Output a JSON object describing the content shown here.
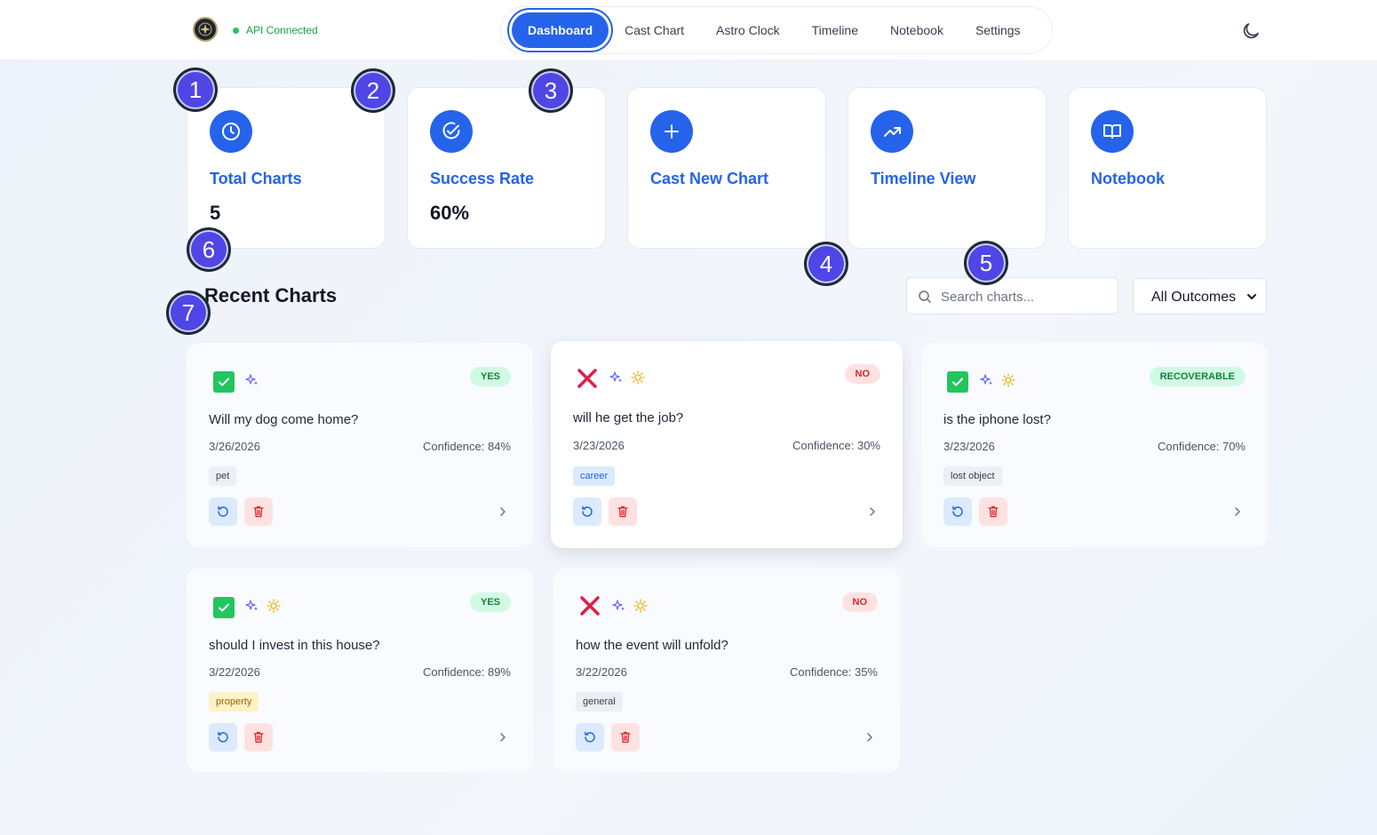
{
  "header": {
    "api_status": "API Connected",
    "nav": [
      "Dashboard",
      "Cast Chart",
      "Astro Clock",
      "Timeline",
      "Notebook",
      "Settings"
    ],
    "active_nav": "Dashboard"
  },
  "stats": [
    {
      "title": "Total Charts",
      "value": "5",
      "icon": "clock-icon"
    },
    {
      "title": "Success Rate",
      "value": "60%",
      "icon": "check-circle-icon"
    },
    {
      "title": "Cast New Chart",
      "value": "",
      "icon": "plus-icon"
    },
    {
      "title": "Timeline View",
      "value": "",
      "icon": "trending-up-icon"
    },
    {
      "title": "Notebook",
      "value": "",
      "icon": "book-icon"
    }
  ],
  "recent": {
    "title": "Recent Charts",
    "search_placeholder": "Search charts...",
    "filter_selected": "All Outcomes"
  },
  "charts": [
    {
      "question": "Will my dog come home?",
      "date": "3/26/2026",
      "confidence": "Confidence: 84%",
      "outcome": "YES",
      "tag": "pet",
      "status": "check-icon"
    },
    {
      "question": "will he get the job?",
      "date": "3/23/2026",
      "confidence": "Confidence: 30%",
      "outcome": "NO",
      "tag": "career",
      "status": "x-icon"
    },
    {
      "question": "is the iphone lost?",
      "date": "3/23/2026",
      "confidence": "Confidence: 70%",
      "outcome": "RECOVERABLE",
      "tag": "lost object",
      "status": "check-icon"
    },
    {
      "question": "should I invest in this house?",
      "date": "3/22/2026",
      "confidence": "Confidence: 89%",
      "outcome": "YES",
      "tag": "property",
      "status": "check-icon"
    },
    {
      "question": "how the event will unfold?",
      "date": "3/22/2026",
      "confidence": "Confidence: 35%",
      "outcome": "NO",
      "tag": "general",
      "status": "x-icon"
    }
  ],
  "markers": [
    "1",
    "2",
    "3",
    "4",
    "5",
    "6",
    "7"
  ],
  "colors": {
    "accent": "#2563eb",
    "success": "#22c55e",
    "danger": "#e11d48",
    "marker": "#4f46e5"
  }
}
